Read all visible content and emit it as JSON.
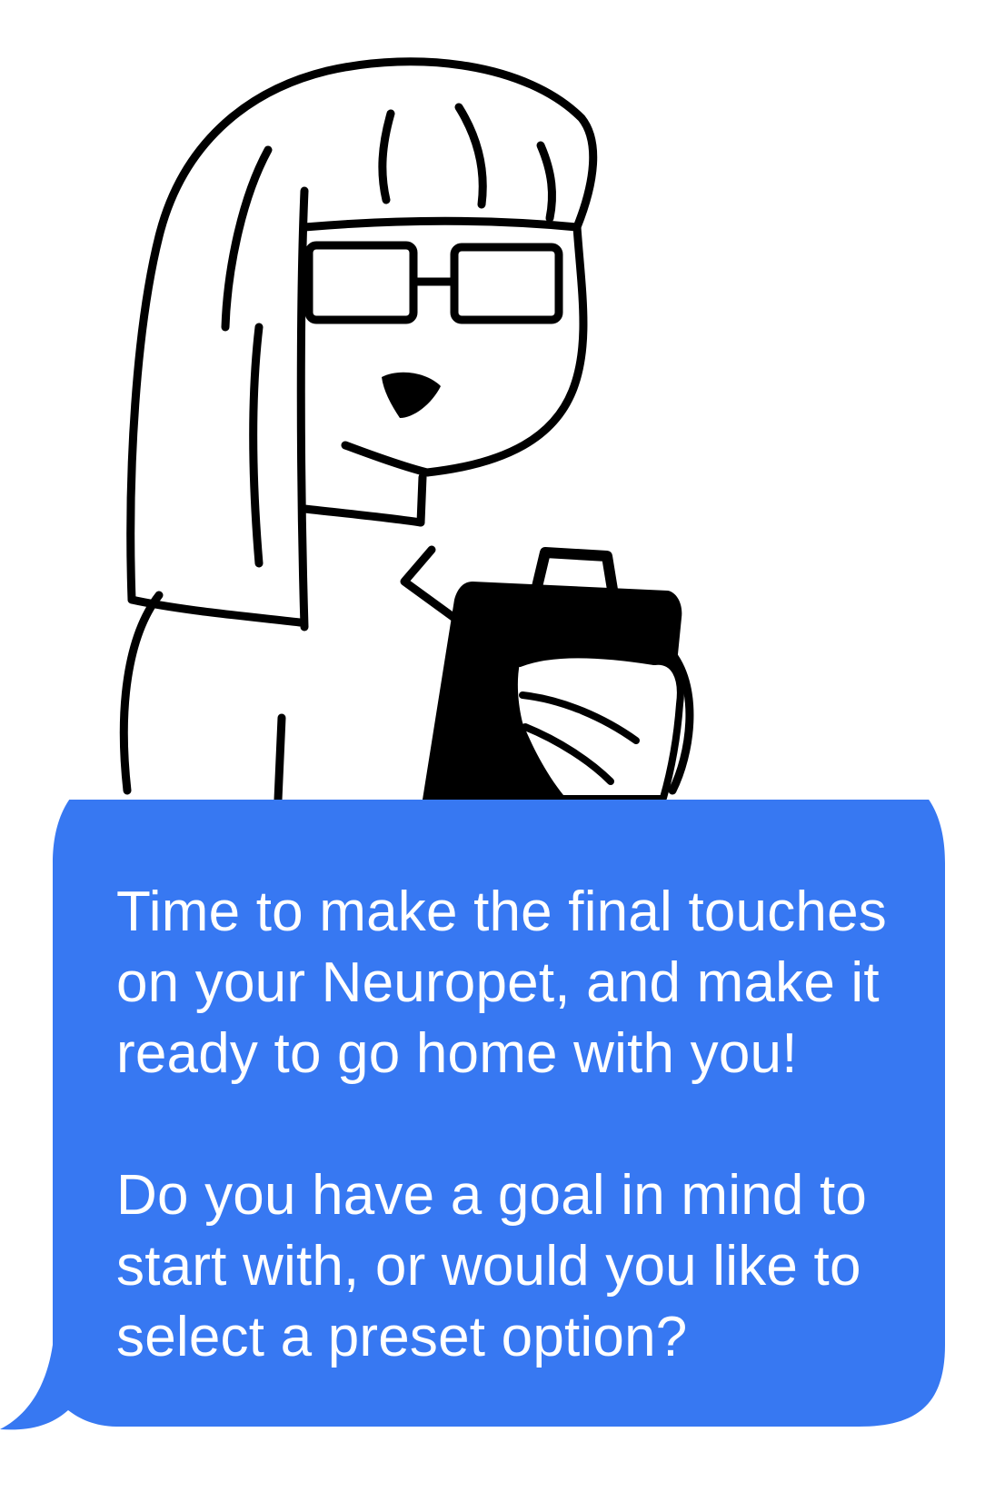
{
  "character": {
    "icon": "scientist-with-clipboard-illustration"
  },
  "chat_bubble": {
    "color": "#3778F2",
    "text_color": "#FFFFFF",
    "paragraph_1": "Time to make the final touches on your Neuropet, and make it ready to go home with you!",
    "paragraph_2": "Do you have a goal in mind to start with, or would you like to select a preset option?"
  }
}
